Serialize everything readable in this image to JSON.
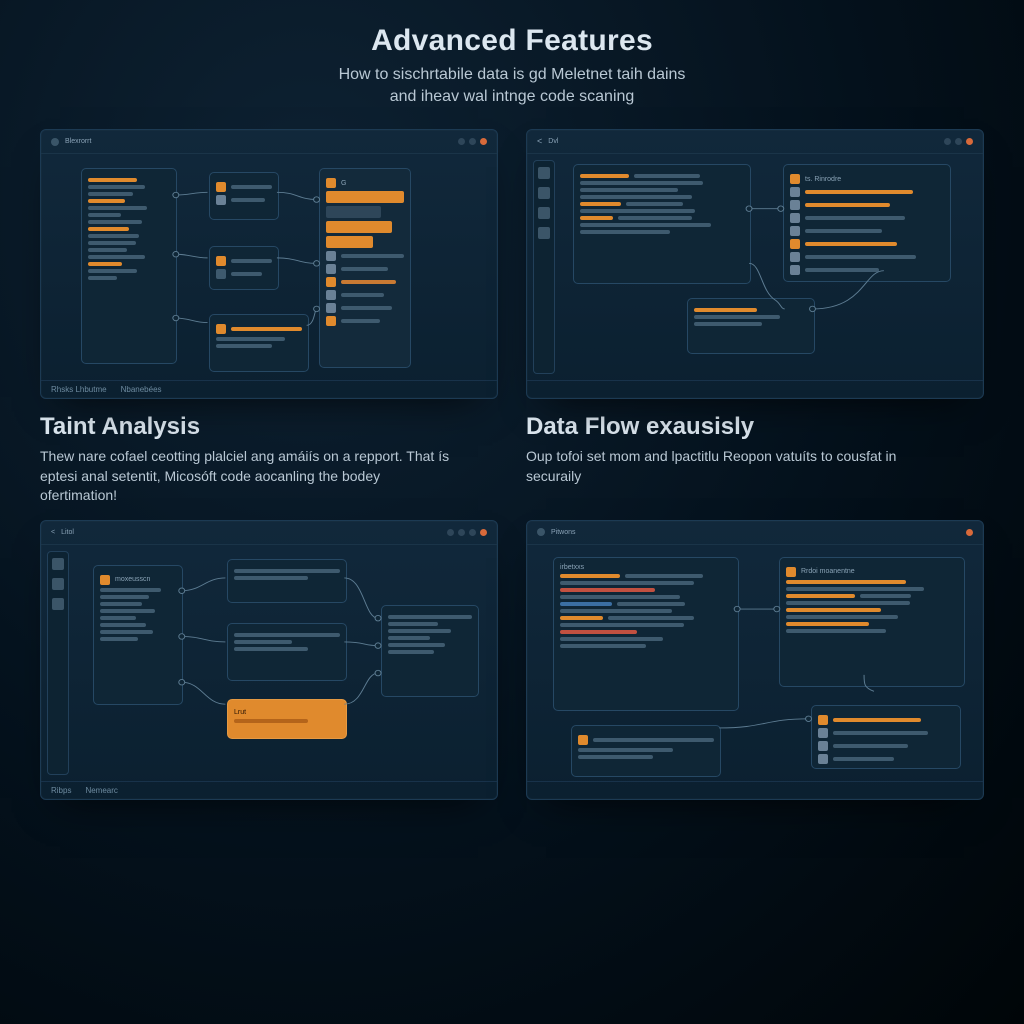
{
  "hero": {
    "title": "Advanced Features",
    "subtitle_line1": "How to sischrtabile data is gd Meletnet taih dains",
    "subtitle_line2": "and iheav wal intnge code scaning"
  },
  "sections": {
    "taint": {
      "title": "Taint Analysis",
      "body": "Thew nare cofael ceotting plalciel ang amáiís on a repport. That ís eptesi anal setentit, Micosóft code aocanling the bodey ofertimation!"
    },
    "flow": {
      "title": "Data Flow exausisly",
      "body": "Oup tofoi set mom and lpactitlu Reopon vatuíts to cousfat in securaily"
    }
  },
  "panels": {
    "p1": {
      "title": "Blexrorrt",
      "footer_left": "Rhsks Lhbutme",
      "footer_right": "Nbanebées"
    },
    "p2": {
      "title": "Dvl",
      "footer": ""
    },
    "p3": {
      "title": "Litol",
      "footer_left": "Ribps",
      "footer_right": "Nemearc"
    },
    "p4": {
      "title": "Pitwons",
      "footer": ""
    }
  },
  "labels": {
    "card_p2_r": "ts. Rinrodre",
    "card_p4_r": "Rrdoi moanentne"
  },
  "colors": {
    "accent": "#e08a2d",
    "panel": "#11283b",
    "line": "#5d7c92"
  }
}
